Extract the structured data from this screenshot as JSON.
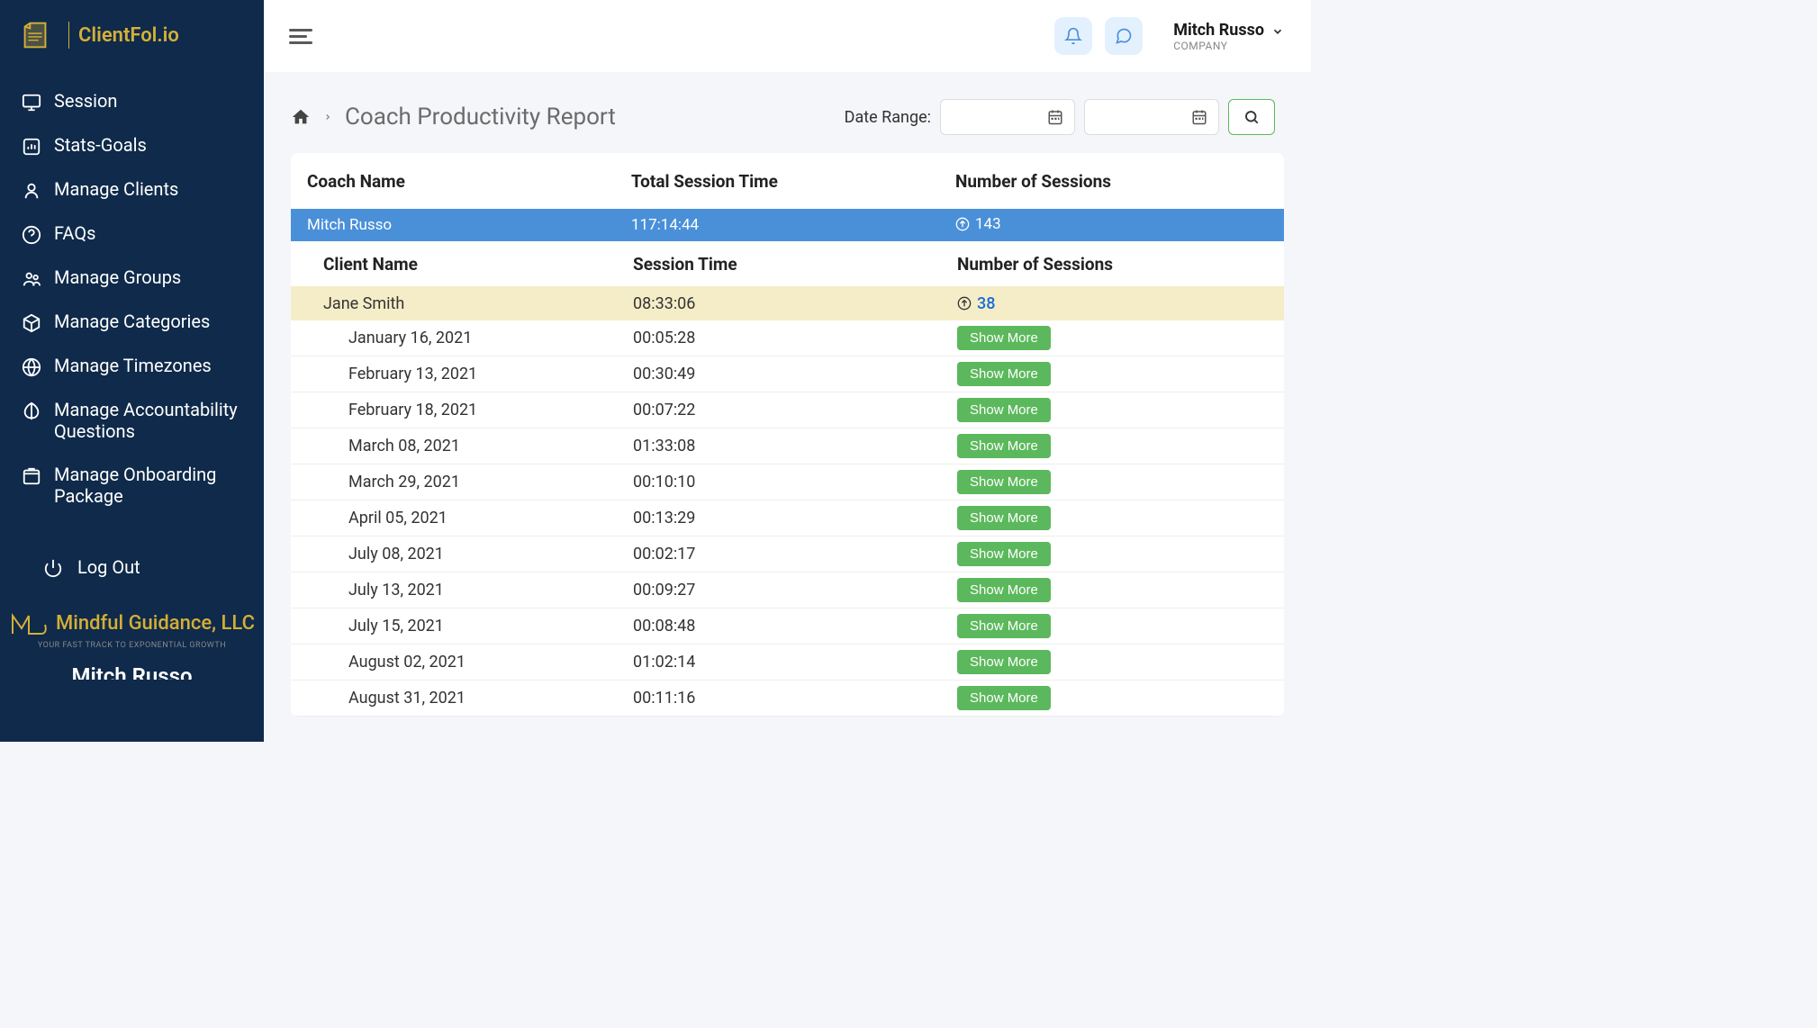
{
  "brand": {
    "name": "ClientFol.io"
  },
  "sidebar": {
    "items": [
      {
        "label": "Session"
      },
      {
        "label": "Stats-Goals"
      },
      {
        "label": "Manage Clients"
      },
      {
        "label": "FAQs"
      },
      {
        "label": "Manage Groups"
      },
      {
        "label": "Manage Categories"
      },
      {
        "label": "Manage Timezones"
      },
      {
        "label": "Manage Accountability Questions"
      },
      {
        "label": "Manage Onboarding Package"
      }
    ],
    "logout": "Log Out",
    "company": "Mindful Guidance, LLC",
    "tagline": "YOUR FAST TRACK TO EXPONENTIAL GROWTH",
    "footer_name": "Mitch Russo"
  },
  "topbar": {
    "user_name": "Mitch Russo",
    "user_company": "COMPANY"
  },
  "header": {
    "title": "Coach Productivity Report",
    "date_range_label": "Date Range:"
  },
  "table": {
    "headers": {
      "coach_name": "Coach Name",
      "total_session_time": "Total Session Time",
      "number_of_sessions": "Number of Sessions",
      "client_name": "Client Name",
      "session_time": "Session Time"
    },
    "coach": {
      "name": "Mitch Russo",
      "total_time": "117:14:44",
      "sessions": "143"
    },
    "client": {
      "name": "Jane Smith",
      "time": "08:33:06",
      "sessions": "38"
    },
    "sessions": [
      {
        "date": "January 16, 2021",
        "time": "00:05:28"
      },
      {
        "date": "February 13, 2021",
        "time": "00:30:49"
      },
      {
        "date": "February 18, 2021",
        "time": "00:07:22"
      },
      {
        "date": "March 08, 2021",
        "time": "01:33:08"
      },
      {
        "date": "March 29, 2021",
        "time": "00:10:10"
      },
      {
        "date": "April 05, 2021",
        "time": "00:13:29"
      },
      {
        "date": "July 08, 2021",
        "time": "00:02:17"
      },
      {
        "date": "July 13, 2021",
        "time": "00:09:27"
      },
      {
        "date": "July 15, 2021",
        "time": "00:08:48"
      },
      {
        "date": "August 02, 2021",
        "time": "01:02:14"
      },
      {
        "date": "August 31, 2021",
        "time": "00:11:16"
      }
    ],
    "show_more": "Show More"
  }
}
